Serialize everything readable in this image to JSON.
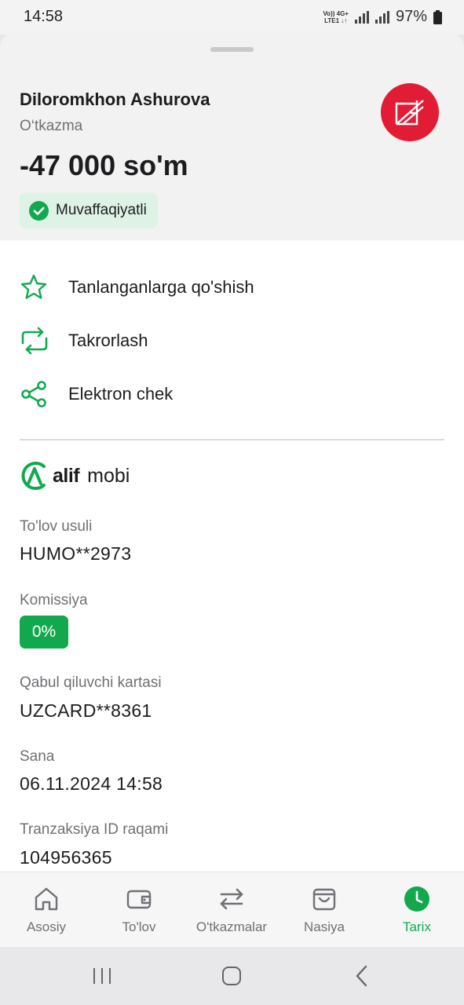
{
  "status_bar": {
    "time": "14:58",
    "network_top": "Vo)) 4G+",
    "network_bottom": "LTE1 ↓↑",
    "battery": "97%"
  },
  "transaction": {
    "recipient": "Diloromkhon Ashurova",
    "type": "O‘tkazma",
    "amount": "-47 000 so'm",
    "status": "Muvaffaqiyatli"
  },
  "actions": [
    {
      "label": "Tanlanganlarga qo'shish",
      "icon": "star-icon"
    },
    {
      "label": "Takrorlash",
      "icon": "repeat-icon"
    },
    {
      "label": "Elektron chek",
      "icon": "share-icon"
    }
  ],
  "brand": {
    "part1": "alif",
    "part2": "mobi"
  },
  "details": {
    "payment_method_label": "To'lov usuli",
    "payment_method_value": "HUMO**2973",
    "fee_label": "Komissiya",
    "fee_value": "0%",
    "recipient_card_label": "Qabul qiluvchi kartasi",
    "recipient_card_value": "UZCARD**8361",
    "date_label": "Sana",
    "date_value": "06.11.2024 14:58",
    "txn_id_label": "Tranzaksiya ID raqami",
    "txn_id_value": "104956365"
  },
  "bottom_nav": [
    {
      "label": "Asosiy",
      "icon": "home-icon",
      "active": false
    },
    {
      "label": "To'lov",
      "icon": "wallet-icon",
      "active": false
    },
    {
      "label": "O'tkazmalar",
      "icon": "transfer-icon",
      "active": false
    },
    {
      "label": "Nasiya",
      "icon": "shopping-bag-icon",
      "active": false
    },
    {
      "label": "Tarix",
      "icon": "clock-icon",
      "active": true
    }
  ],
  "colors": {
    "accent": "#12a94e",
    "bank_logo": "#e21c35",
    "success_bg": "#dff2e6"
  }
}
